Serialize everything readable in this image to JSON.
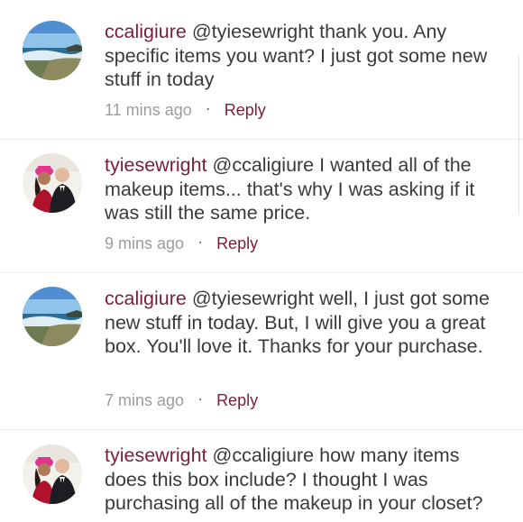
{
  "comments": [
    {
      "username": "ccaligiure",
      "text": "@tyiesewright thank you. Any specific items you want? I just got some new stuff in today",
      "time": "11 mins ago",
      "separator": "·",
      "reply": "Reply",
      "avatar": "seascape-avatar"
    },
    {
      "username": "tyiesewright",
      "text": "@ccaligiure I wanted all of the makeup items... that's why I was asking if it was still the same price.",
      "time": "9 mins ago",
      "separator": "·",
      "reply": "Reply",
      "avatar": "couple-photo-avatar"
    },
    {
      "username": "ccaligiure",
      "text": "@tyiesewright well, I just got some new stuff in today. But, I will give you a great box. You'll love it. Thanks for your purchase.",
      "time": "7 mins ago",
      "separator": "·",
      "reply": "Reply",
      "avatar": "seascape-avatar"
    },
    {
      "username": "tyiesewright",
      "text": "@ccaligiure how many items does this box include? I thought I was purchasing all of the makeup in your closet?",
      "time": "",
      "separator": "",
      "reply": "",
      "avatar": "couple-photo-avatar"
    }
  ],
  "colors": {
    "username": "#7a1f36",
    "text": "#3a3a3a",
    "meta": "#9c9c9c",
    "reply": "#7a1f36"
  }
}
